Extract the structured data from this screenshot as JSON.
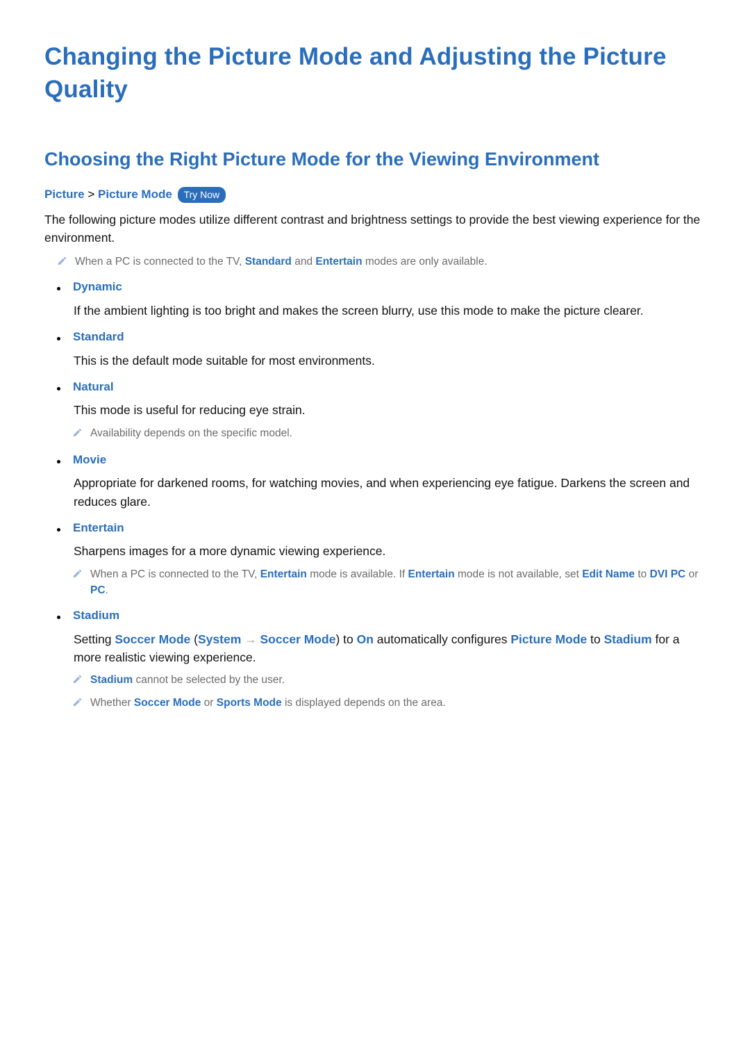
{
  "page_title": "Changing the Picture Mode and Adjusting the Picture Quality",
  "section_title": "Choosing the Right Picture Mode for the Viewing Environment",
  "breadcrumb": {
    "root": "Picture",
    "sep": ">",
    "leaf": "Picture Mode",
    "try_now": "Try Now"
  },
  "intro": "The following picture modes utilize different contrast and brightness settings to provide the best viewing experience for the environment.",
  "note_pc": {
    "pre": "When a PC is connected to the TV, ",
    "standard": "Standard",
    "mid": " and ",
    "entertain": "Entertain",
    "post": " modes are only available."
  },
  "modes": {
    "dynamic": {
      "title": "Dynamic",
      "body": "If the ambient lighting is too bright and makes the screen blurry, use this mode to make the picture clearer."
    },
    "standard": {
      "title": "Standard",
      "body": "This is the default mode suitable for most environments."
    },
    "natural": {
      "title": "Natural",
      "body": "This mode is useful for reducing eye strain.",
      "note": "Availability depends on the specific model."
    },
    "movie": {
      "title": "Movie",
      "body": "Appropriate for darkened rooms, for watching movies, and when experiencing eye fatigue. Darkens the screen and reduces glare."
    },
    "entertain": {
      "title": "Entertain",
      "body": "Sharpens images for a more dynamic viewing experience.",
      "note": {
        "pre": "When a PC is connected to the TV, ",
        "e1": "Entertain",
        "mid1": " mode is available. If ",
        "e2": "Entertain",
        "mid2": " mode is not available, set ",
        "edit_name": "Edit Name",
        "to": " to ",
        "dvipc": "DVI PC",
        "or": " or ",
        "pc": "PC",
        "end": "."
      }
    },
    "stadium": {
      "title": "Stadium",
      "body": {
        "setting": "Setting ",
        "soccer_mode1": "Soccer Mode",
        "open": " (",
        "system": "System",
        "arrow": " → ",
        "soccer_mode2": "Soccer Mode",
        "close": ") to ",
        "on": "On",
        "mid": " automatically configures ",
        "picture_mode": "Picture Mode",
        "to": " to ",
        "stadium": "Stadium",
        "rest": " for a more realistic viewing experience."
      },
      "note1": {
        "stadium": "Stadium",
        "rest": " cannot be selected by the user."
      },
      "note2": {
        "pre": "Whether ",
        "soccer": "Soccer Mode",
        "or": " or ",
        "sports": "Sports Mode",
        "post": " is displayed depends on the area."
      }
    }
  }
}
